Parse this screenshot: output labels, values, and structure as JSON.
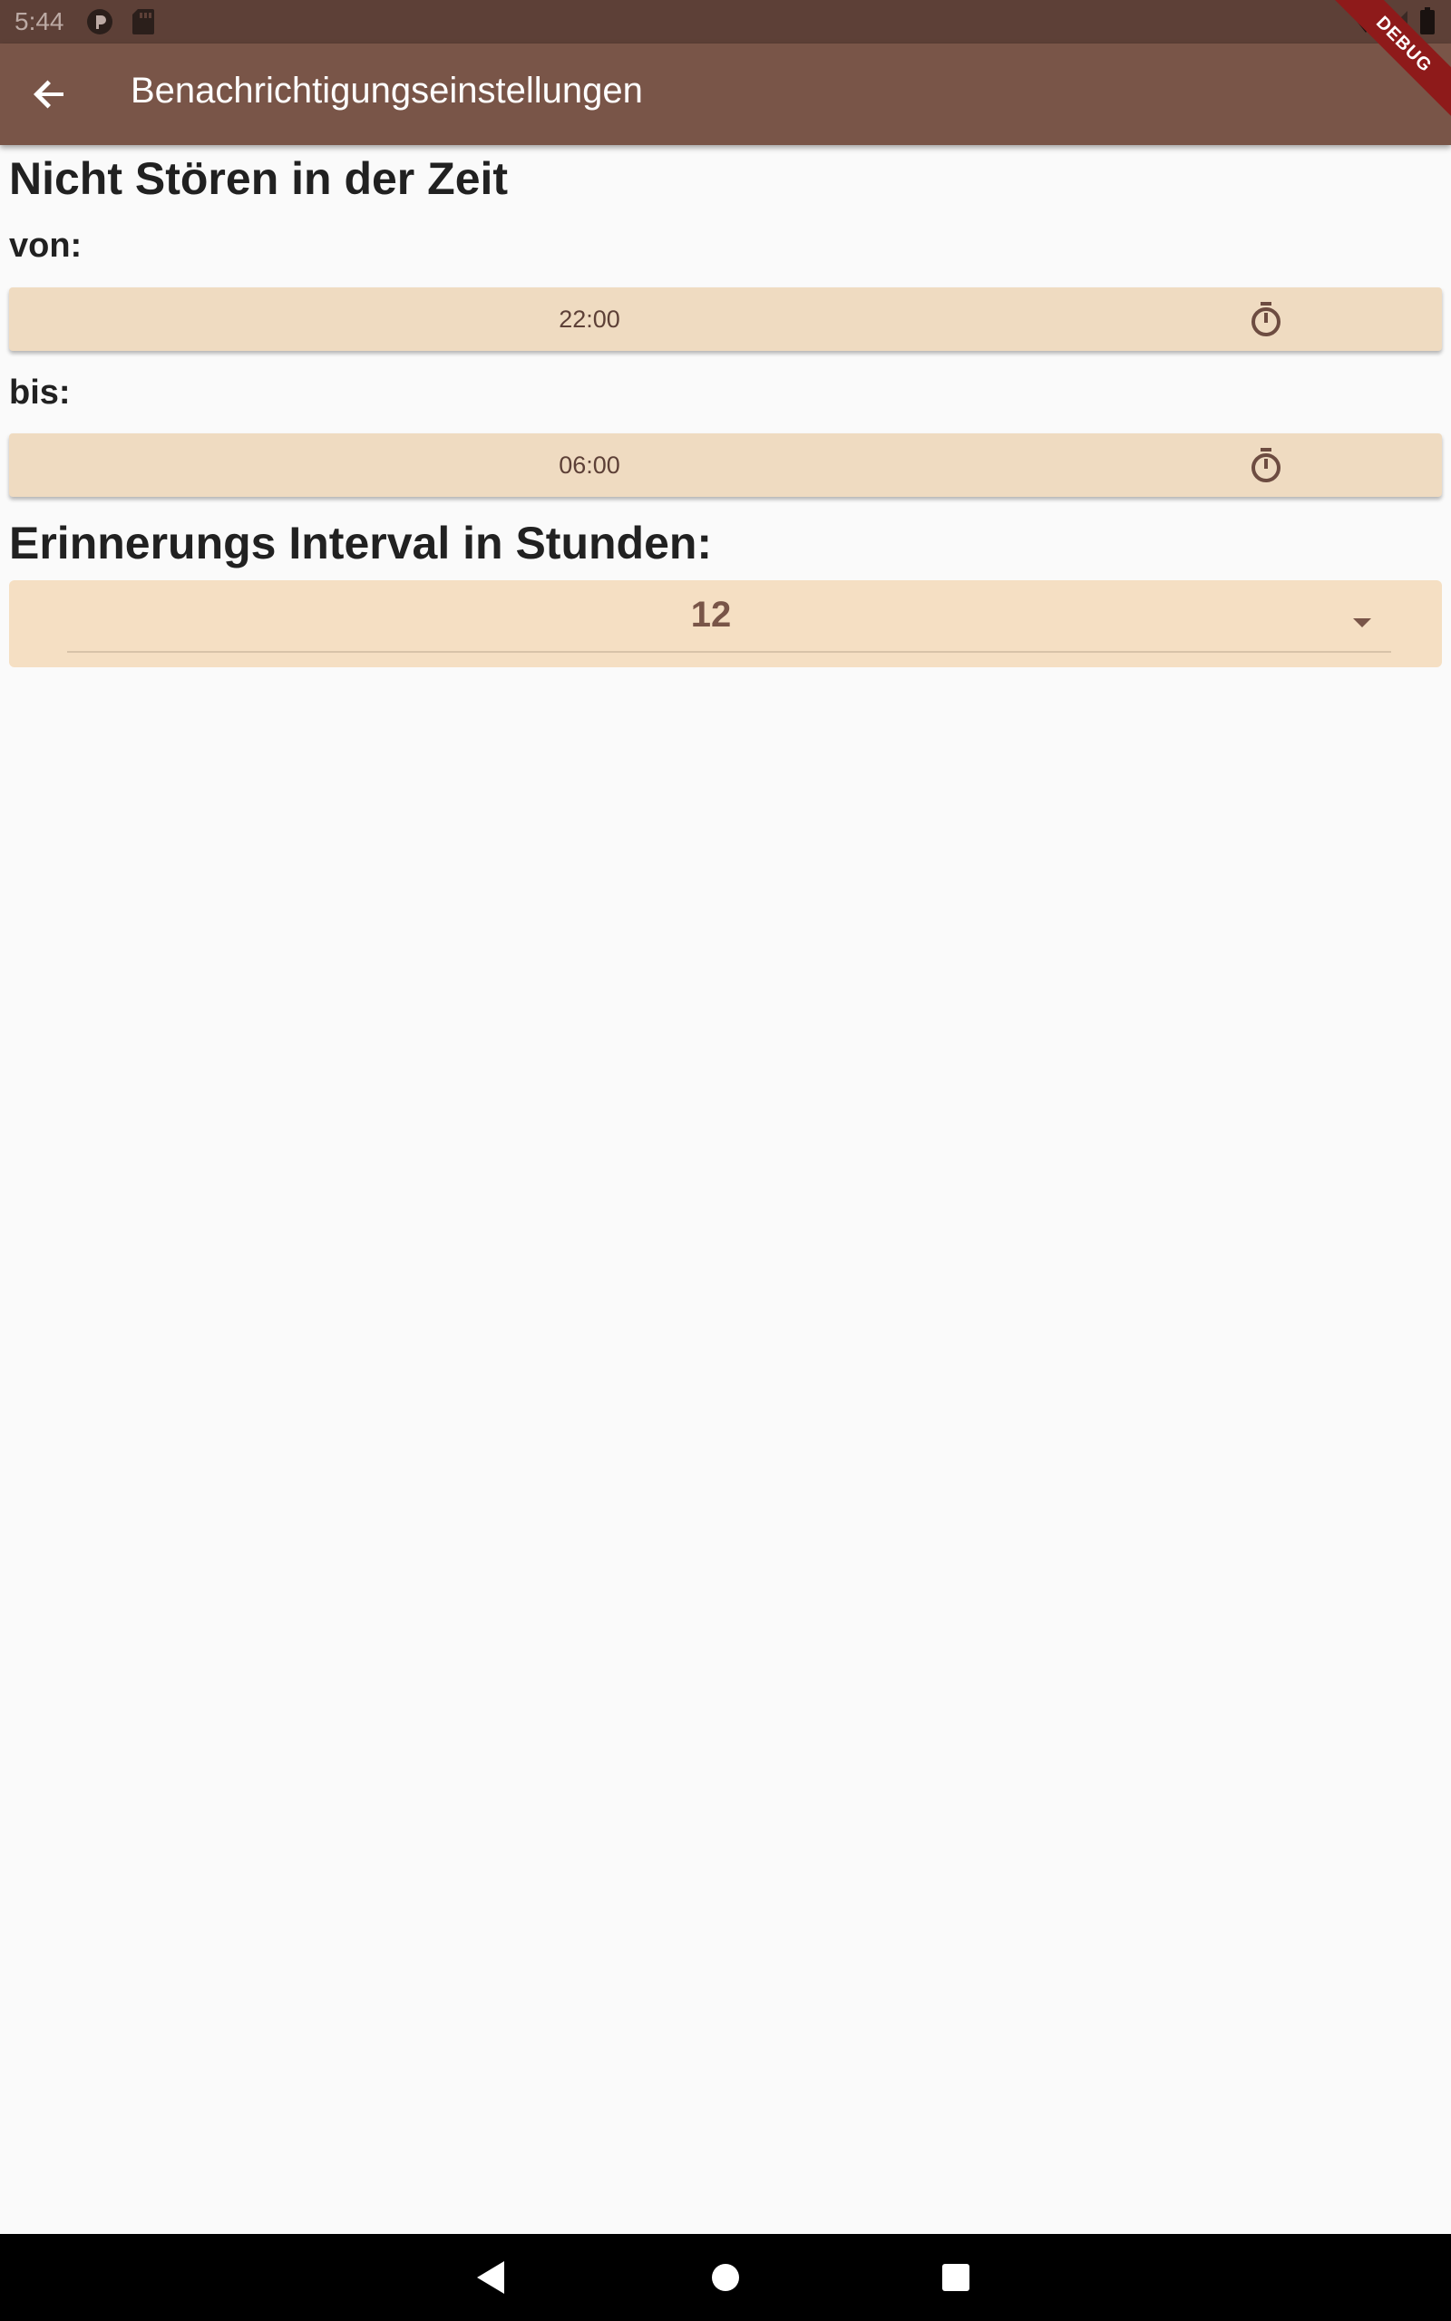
{
  "status_bar": {
    "time": "5:44"
  },
  "app_bar": {
    "title": "Benachrichtigungseinstellungen",
    "debug_label": "DEBUG"
  },
  "do_not_disturb": {
    "title": "Nicht Stören in der Zeit",
    "from_label": "von:",
    "from_value": "22:00",
    "to_label": "bis:",
    "to_value": "06:00"
  },
  "reminder": {
    "title": "Erinnerungs Interval in Stunden:",
    "selected_value": "12"
  },
  "icons": {
    "back": "arrow-back-icon",
    "timer": "timer-icon",
    "dropdown": "arrow-drop-down-icon",
    "nav_back": "nav-back-icon",
    "nav_home": "nav-home-icon",
    "nav_recents": "nav-recents-icon"
  },
  "colors": {
    "status_bar": "#5d4037",
    "app_bar": "#795548",
    "button_bg": "#efdbc1",
    "accent_text": "#795548"
  }
}
